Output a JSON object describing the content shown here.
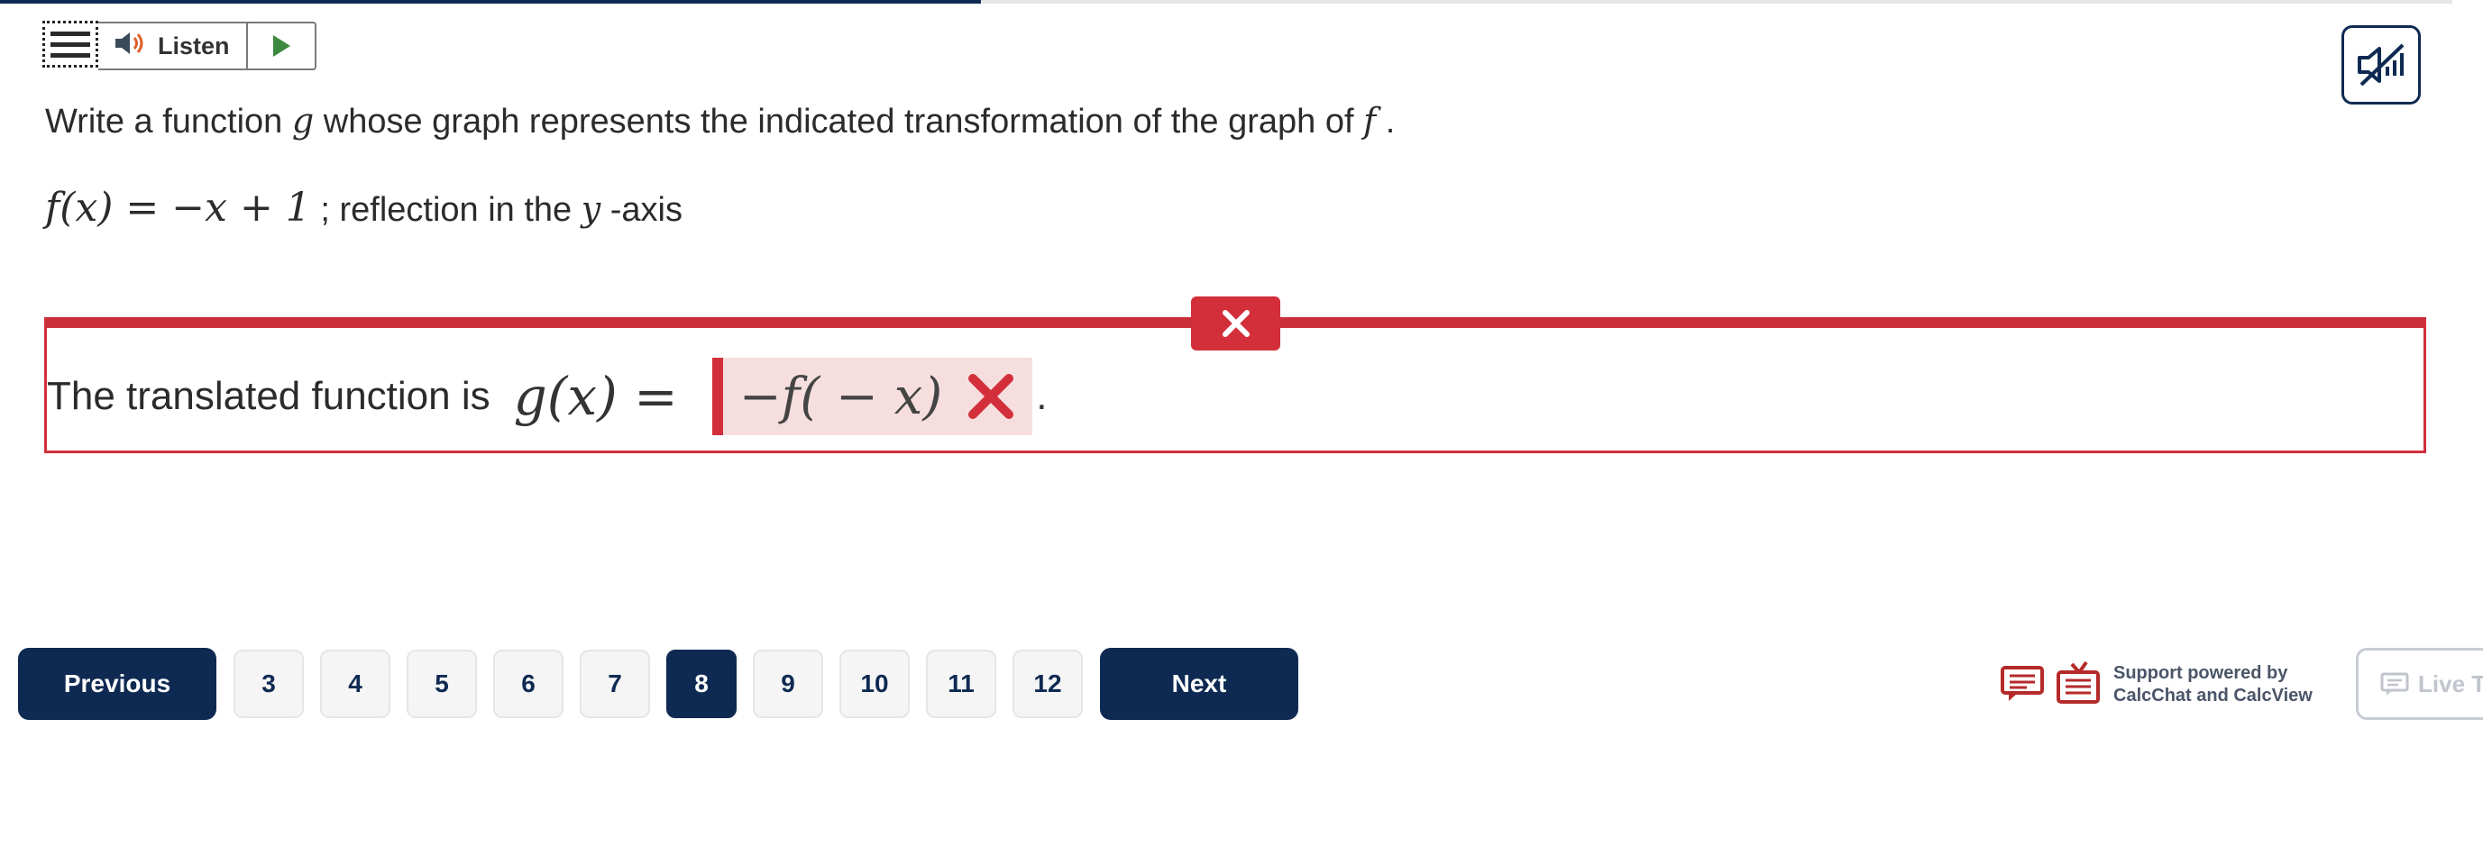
{
  "progress": {
    "fraction": 0.4
  },
  "toolbar": {
    "menu_icon": "hamburger-menu-icon",
    "listen_label": "Listen",
    "speaker_icon": "speaker-icon",
    "play_icon": "play-icon"
  },
  "mute_icon": "mute-audio-icon",
  "question": {
    "prompt_before": "Write a function ",
    "prompt_var_g": "g",
    "prompt_middle": " whose graph represents the indicated transformation of the graph of ",
    "prompt_var_f": "f",
    "prompt_end": " .",
    "function_def": "f(x) = −x + 1",
    "sub_text_before": " ; reflection in the ",
    "sub_var_y": "y",
    "sub_text_after": " -axis"
  },
  "answer": {
    "label": "The translated function is",
    "lhs": "g(x) =",
    "value": "−f( − x)",
    "status": "incorrect",
    "period": "."
  },
  "nav": {
    "previous_label": "Previous",
    "next_label": "Next",
    "pages": [
      "3",
      "4",
      "5",
      "6",
      "7",
      "8",
      "9",
      "10",
      "11",
      "12"
    ],
    "current_page": "8"
  },
  "support": {
    "line1": "Support powered by",
    "line2": "CalcChat and CalcView",
    "calcchat_icon": "calcchat-icon",
    "calcview_icon": "calcview-icon"
  },
  "live_tutor": {
    "label": "Live Tu",
    "icon": "chat-icon"
  },
  "colors": {
    "navy": "#0f2a52",
    "error_red": "#d22f3b",
    "error_bg": "#f7dede",
    "play_green": "#3c8a3f",
    "support_red": "#b52a2a"
  }
}
